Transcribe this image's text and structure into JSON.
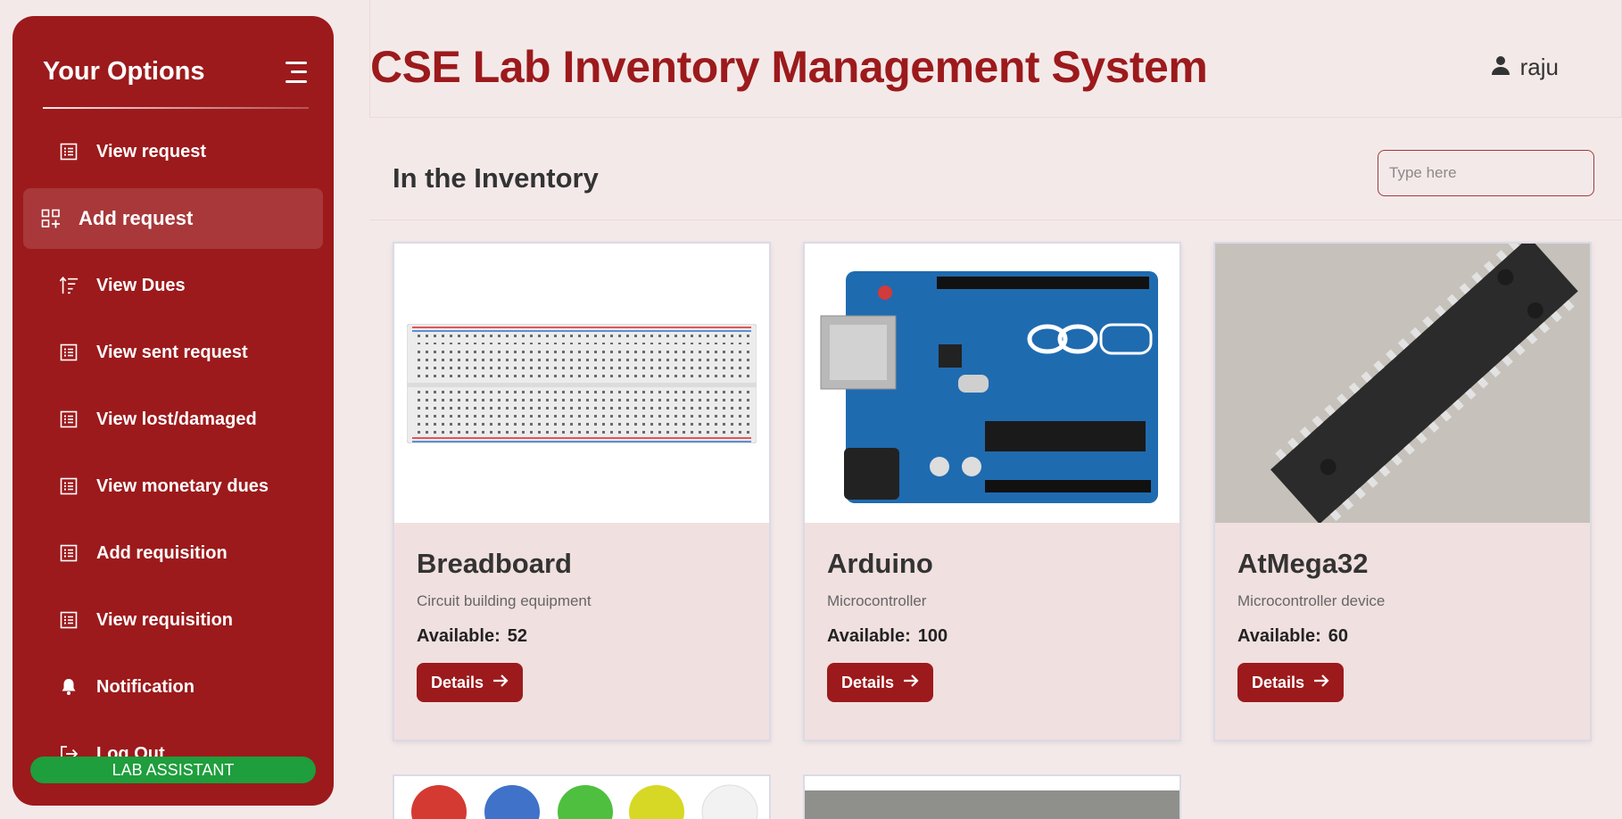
{
  "sidebar": {
    "title": "Your Options",
    "toggle_icon": "hamburger-menu-icon",
    "items": [
      {
        "label": "View request",
        "icon": "list-icon"
      },
      {
        "label": "Add request",
        "icon": "grid-add-icon",
        "active": true
      },
      {
        "label": "View Dues",
        "icon": "sort-ascending-icon"
      },
      {
        "label": "View sent request",
        "icon": "list-icon"
      },
      {
        "label": "View lost/damaged",
        "icon": "list-icon"
      },
      {
        "label": "View monetary dues",
        "icon": "list-icon"
      },
      {
        "label": "Add requisition",
        "icon": "list-icon"
      },
      {
        "label": "View requisition",
        "icon": "list-icon"
      },
      {
        "label": "Notification",
        "icon": "bell-icon"
      },
      {
        "label": "Log Out",
        "icon": "logout-icon"
      }
    ],
    "role_badge": "LAB ASSISTANT"
  },
  "header": {
    "title": "CSE Lab Inventory Management System",
    "user": "raju"
  },
  "inventory": {
    "section_title": "In the Inventory",
    "search_placeholder": "Type here",
    "available_label": "Available:",
    "details_label": "Details",
    "items": [
      {
        "name": "Breadboard",
        "description": "Circuit building equipment",
        "available": "52",
        "image": "breadboard-image"
      },
      {
        "name": "Arduino",
        "description": "Microcontroller",
        "available": "100",
        "image": "arduino-board-image"
      },
      {
        "name": "AtMega32",
        "description": "Microcontroller device",
        "available": "60",
        "image": "atmega32-chip-image"
      }
    ]
  },
  "colors": {
    "brand": "#9c1a1c",
    "background": "#f4e9e9",
    "badge": "#1e9e3c"
  }
}
